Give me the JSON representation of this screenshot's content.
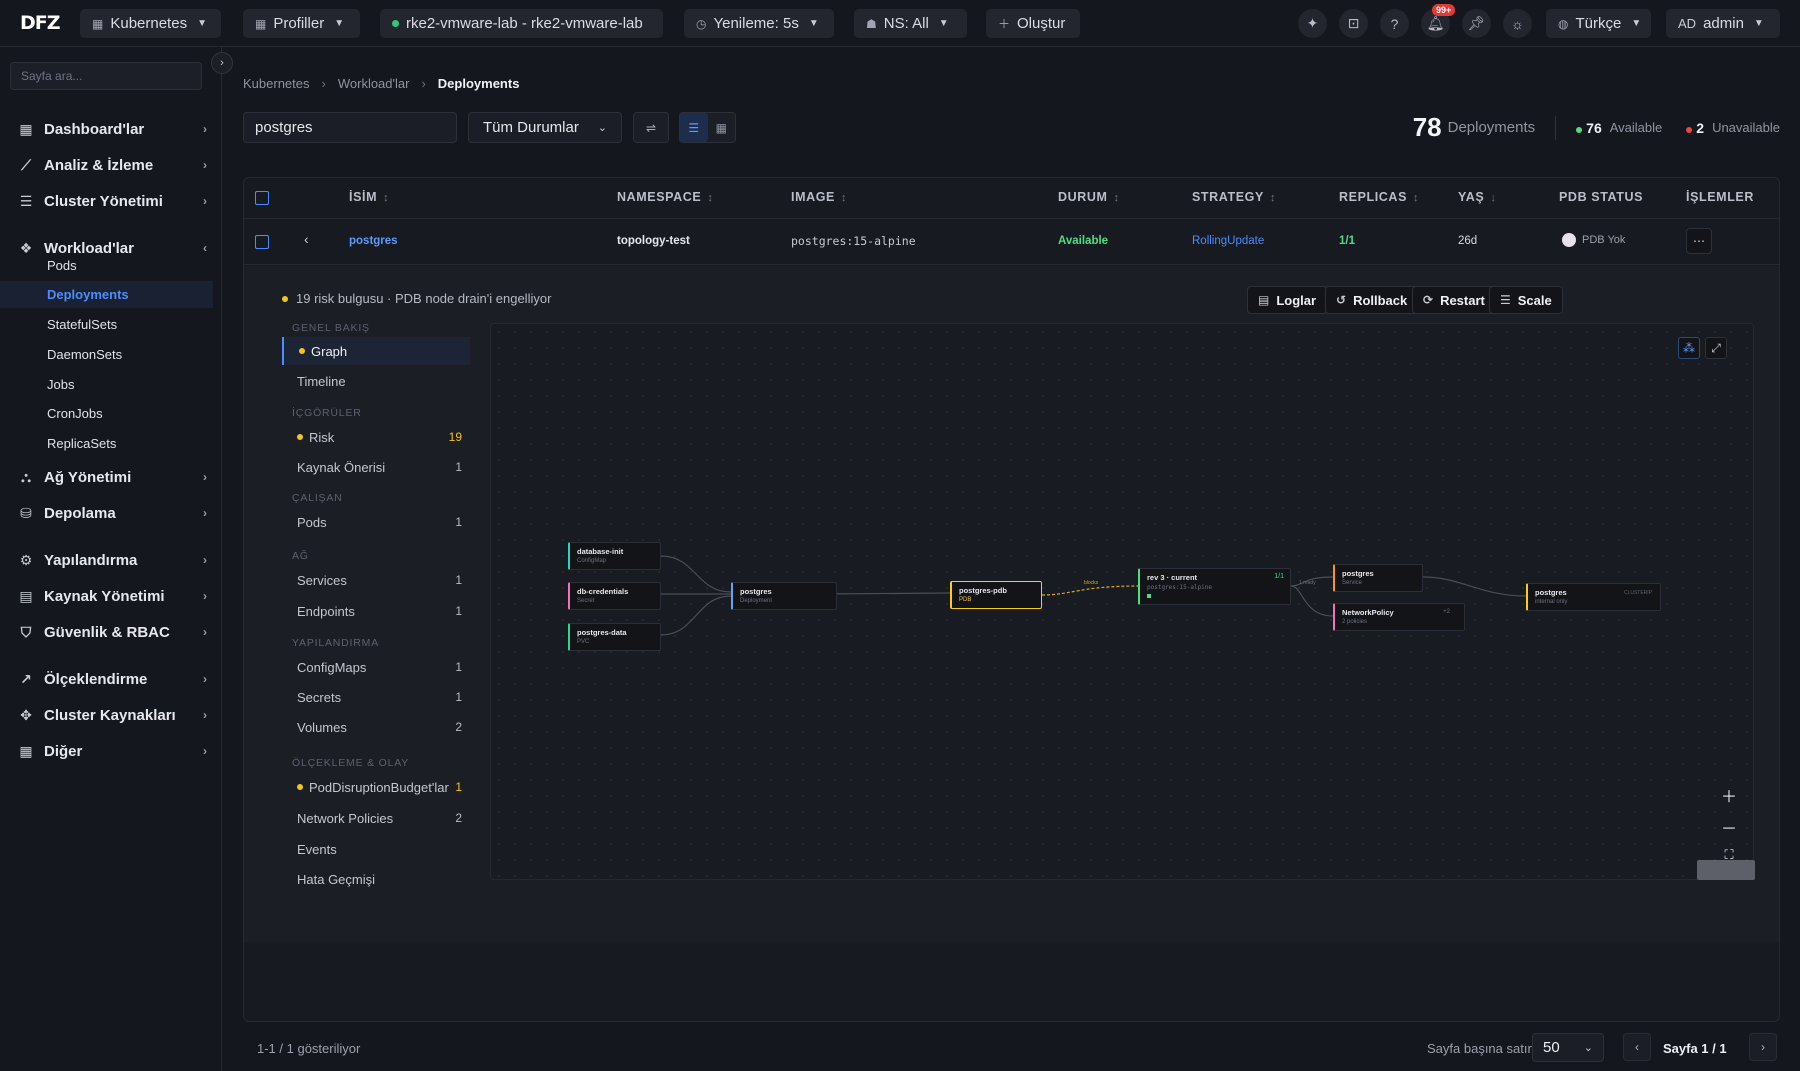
{
  "topbar": {
    "logo": "DFZ",
    "kubernetes": "Kubernetes",
    "profiles": "Profiller",
    "cluster": "rke2-vmware-lab - rke2-vmware-lab",
    "refresh": "Yenileme: 5s",
    "namespace": "NS: All",
    "create": "Oluştur",
    "notification_badge": "99+",
    "language": "Türkçe",
    "user_initials": "AD",
    "user": "admin"
  },
  "sidebar": {
    "search_placeholder": "Sayfa ara...",
    "items": {
      "dashboards": "Dashboard'lar",
      "analysis": "Analiz & İzleme",
      "cluster": "Cluster Yönetimi",
      "workloads": "Workload'lar",
      "network": "Ağ Yönetimi",
      "storage": "Depolama",
      "config": "Yapılandırma",
      "resources": "Kaynak Yönetimi",
      "security": "Güvenlik & RBAC",
      "scaling": "Ölçeklendirme",
      "cluster_resources": "Cluster Kaynakları",
      "other": "Diğer"
    },
    "workload_subs": {
      "pods": "Pods",
      "deployments": "Deployments",
      "statefulsets": "StatefulSets",
      "daemonsets": "DaemonSets",
      "jobs": "Jobs",
      "cronjobs": "CronJobs",
      "replicasets": "ReplicaSets"
    }
  },
  "breadcrumb": {
    "root": "Kubernetes",
    "workloads": "Workload'lar",
    "current": "Deployments"
  },
  "filters": {
    "search_value": "postgres",
    "status": "Tüm Durumlar"
  },
  "stats": {
    "total": "78",
    "total_label": "Deployments",
    "available": "76",
    "available_label": "Available",
    "unavailable": "2",
    "unavailable_label": "Unavailable"
  },
  "table": {
    "headers": {
      "name": "İSİM",
      "namespace": "NAMESPACE",
      "image": "IMAGE",
      "status": "DURUM",
      "strategy": "STRATEGY",
      "replicas": "REPLICAS",
      "age": "YAŞ",
      "pdb": "PDB STATUS",
      "actions": "İŞLEMLER"
    },
    "row": {
      "name": "postgres",
      "namespace": "topology-test",
      "image": "postgres:15-alpine",
      "status": "Available",
      "strategy": "RollingUpdate",
      "replicas": "1/1",
      "age": "26d",
      "pdb": "PDB Yok"
    }
  },
  "detail": {
    "warning": "19 risk bulgusu · PDB node drain'i engelliyor",
    "actions": {
      "logs": "Loglar",
      "rollback": "Rollback",
      "restart": "Restart",
      "scale": "Scale"
    },
    "nav": {
      "h_overview": "GENEL BAKIŞ",
      "graph": "Graph",
      "timeline": "Timeline",
      "h_insights": "İÇGÖRÜLER",
      "risk": "Risk",
      "risk_count": "19",
      "resource_rec": "Kaynak Önerisi",
      "resource_rec_count": "1",
      "h_running": "ÇALIŞAN",
      "pods": "Pods",
      "pods_count": "1",
      "h_network": "AĞ",
      "services": "Services",
      "services_count": "1",
      "endpoints": "Endpoints",
      "endpoints_count": "1",
      "h_config": "YAPILANDIRMA",
      "configmaps": "ConfigMaps",
      "configmaps_count": "1",
      "secrets": "Secrets",
      "secrets_count": "1",
      "volumes": "Volumes",
      "volumes_count": "2",
      "h_scaling": "ÖLÇEKLEME & OLAY",
      "pdb": "PodDisruptionBudget'lar",
      "pdb_count": "1",
      "netpol": "Network Policies",
      "netpol_count": "2",
      "events": "Events",
      "errors": "Hata Geçmişi"
    },
    "graph": {
      "nodes": {
        "dbinit_t": "database-init",
        "dbinit_s": "ConfigMap",
        "dbcred_t": "db-credentials",
        "dbcred_s": "Secret",
        "pgdata_t": "postgres-data",
        "pgdata_s": "PVC",
        "deploy_t": "postgres",
        "deploy_s": "Deployment",
        "pdb_t": "postgres-pdb",
        "pdb_s": "PDB",
        "pdb_edge": "blocks",
        "rs_t": "rev 3 · current",
        "rs_s": "postgres:15-alpine",
        "rs_count": "1/1",
        "rs_edge": "1 ready",
        "svc_t": "postgres",
        "svc_s": "Service",
        "np_t": "NetworkPolicy",
        "np_s": "2 policies",
        "np_more": "+2",
        "ep_t": "postgres",
        "ep_s": "internal only",
        "ep_tag": "CLUSTERIP"
      },
      "colors": {
        "configmap": "#2dd4bf",
        "secret": "#f472b6",
        "pvc": "#34d399",
        "deployment": "#60a5fa",
        "pdb": "#facc15",
        "replicaset": "#4ade80",
        "service": "#f59e0b",
        "netpol": "#f472b6",
        "endpoint": "#facc15"
      }
    }
  },
  "footer": {
    "showing": "1-1 / 1 gösteriliyor",
    "rows_label": "Sayfa başına satır",
    "rows_value": "50",
    "page": "Sayfa 1 / 1"
  },
  "colors": {
    "accent": "#4b8dff",
    "available": "#4ade80",
    "unavailable": "#ef4444",
    "warning": "#f5c518"
  }
}
